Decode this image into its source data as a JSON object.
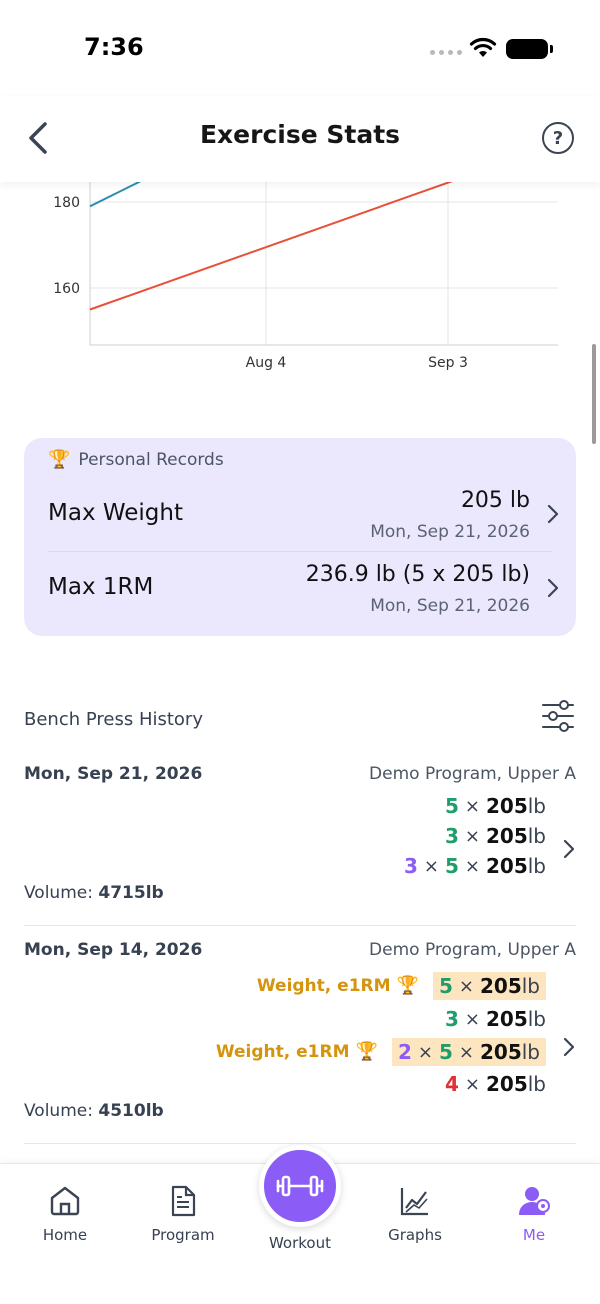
{
  "status_bar": {
    "time": "7:36"
  },
  "header": {
    "title": "Exercise Stats",
    "help": "?"
  },
  "chart_data": {
    "type": "line",
    "x_ticks": [
      "Aug 4",
      "Sep 3"
    ],
    "y_ticks": [
      160,
      180
    ],
    "series": [
      {
        "color": "#2a8fb0",
        "points": [
          [
            0,
            179
          ],
          [
            10,
            186
          ]
        ]
      },
      {
        "color": "#e8503a",
        "points": [
          [
            0,
            155
          ],
          [
            60,
            185
          ]
        ]
      }
    ],
    "grid": true
  },
  "personal_records": {
    "heading": "Personal Records",
    "rows": [
      {
        "label": "Max Weight",
        "value": "205 lb",
        "date": "Mon, Sep 21, 2026"
      },
      {
        "label": "Max 1RM",
        "value": "236.9 lb (5 x 205 lb)",
        "date": "Mon, Sep 21, 2026"
      }
    ]
  },
  "history": {
    "title": "Bench Press History",
    "sessions": [
      {
        "date": "Mon, Sep 21, 2026",
        "program": "Demo Program, Upper A",
        "volume_label": "Volume:",
        "volume": "4715lb",
        "sets": [
          {
            "reps": "5",
            "weight": "205",
            "unit": "lb"
          },
          {
            "reps": "3",
            "weight": "205",
            "unit": "lb"
          },
          {
            "sets": "3",
            "reps": "5",
            "weight": "205",
            "unit": "lb"
          }
        ]
      },
      {
        "date": "Mon, Sep 14, 2026",
        "program": "Demo Program, Upper A",
        "volume_label": "Volume:",
        "volume": "4510lb",
        "sets": [
          {
            "tag": "Weight, e1RM",
            "reps": "5",
            "weight": "205",
            "unit": "lb"
          },
          {
            "reps": "3",
            "weight": "205",
            "unit": "lb"
          },
          {
            "tag": "Weight, e1RM",
            "sets": "2",
            "reps": "5",
            "weight": "205",
            "unit": "lb"
          },
          {
            "reps": "4",
            "weight": "205",
            "unit": "lb"
          }
        ]
      }
    ],
    "times": "×"
  },
  "nav": {
    "items": [
      {
        "label": "Home",
        "icon": "home-icon"
      },
      {
        "label": "Program",
        "icon": "document-icon"
      },
      {
        "label": "Workout",
        "icon": "dumbbell-icon"
      },
      {
        "label": "Graphs",
        "icon": "graph-icon"
      },
      {
        "label": "Me",
        "icon": "profile-icon",
        "active": true
      }
    ]
  },
  "colors": {
    "accent": "#8b5cf6",
    "green": "#1f9d6a",
    "red": "#e03131",
    "gold": "#d4940d",
    "pr_card": "#ebe8fd"
  }
}
